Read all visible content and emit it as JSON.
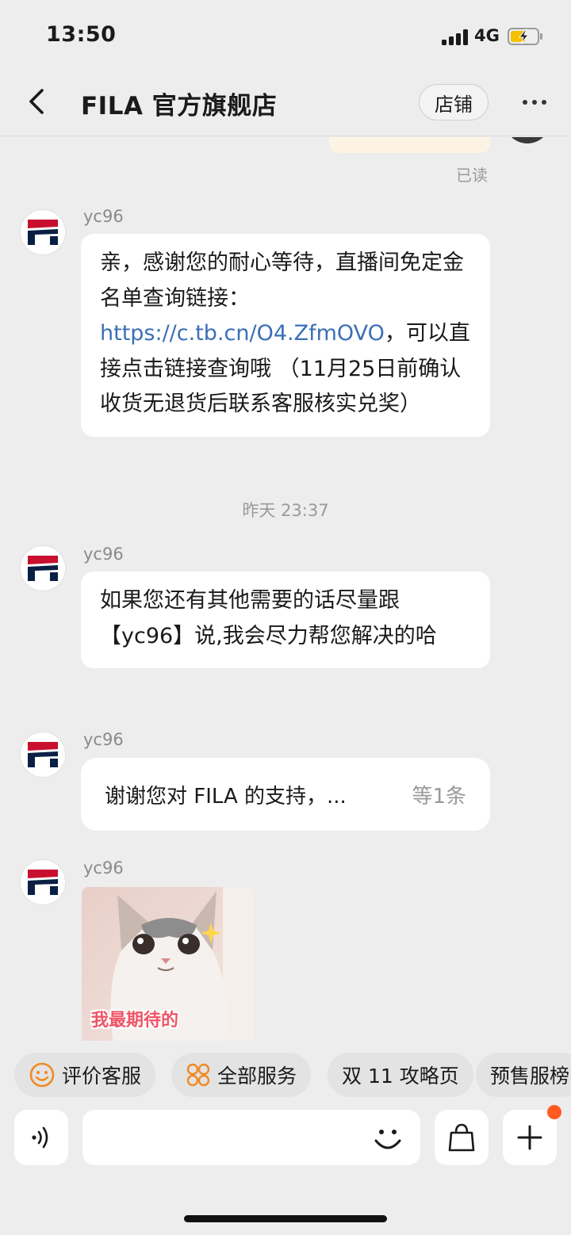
{
  "status_bar": {
    "time": "13:50",
    "network": "4G"
  },
  "nav": {
    "title": "FILA 官方旗舰店",
    "store_button": "店铺"
  },
  "chat": {
    "read_status": "已读",
    "messages": [
      {
        "sender": "yc96",
        "text_before_link": "亲，感谢您的耐心等待，直播间免定金名单查询链接：",
        "link": "https://c.tb.cn/O4.ZfmOVO",
        "text_after_link": "，可以直接点击链接查询哦 （11月25日前确认收货无退货后联系客服核实兑奖）"
      },
      {
        "timestamp": "昨天 23:37"
      },
      {
        "sender": "yc96",
        "text": "如果您还有其他需要的话尽量跟【yc96】说,我会尽力帮您解决的哈"
      },
      {
        "sender": "yc96",
        "folded_text": "谢谢您对 FILA 的支持，...",
        "folded_count": "等1条"
      },
      {
        "sender": "yc96",
        "sticker_text": "我最期待的"
      }
    ]
  },
  "quick_actions": [
    {
      "label": "评价客服",
      "icon": "smiley-icon"
    },
    {
      "label": "全部服务",
      "icon": "grid-icon"
    },
    {
      "label": "双 11 攻略页"
    },
    {
      "label": "预售服榜"
    }
  ],
  "input": {
    "placeholder": ""
  },
  "colors": {
    "background": "#ededed",
    "link": "#3b6fb6",
    "fila_red": "#c8102e",
    "fila_navy": "#0a1f44",
    "badge": "#ff5a1f"
  }
}
